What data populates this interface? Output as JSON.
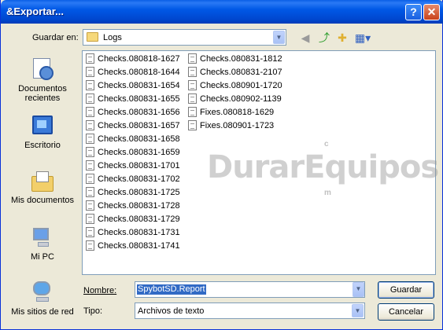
{
  "title": "Exportar...",
  "save_in": {
    "label": "Guardar en:",
    "value": "Logs"
  },
  "places": [
    {
      "label": "Documentos recientes"
    },
    {
      "label": "Escritorio"
    },
    {
      "label": "Mis documentos"
    },
    {
      "label": "Mi PC"
    },
    {
      "label": "Mis sitios de red"
    }
  ],
  "files_col1": [
    "Checks.080818-1627",
    "Checks.080818-1644",
    "Checks.080831-1654",
    "Checks.080831-1655",
    "Checks.080831-1656",
    "Checks.080831-1657",
    "Checks.080831-1658",
    "Checks.080831-1659",
    "Checks.080831-1701",
    "Checks.080831-1702",
    "Checks.080831-1725",
    "Checks.080831-1728",
    "Checks.080831-1729",
    "Checks.080831-1731",
    "Checks.080831-1741"
  ],
  "files_col2": [
    "Checks.080831-1812",
    "Checks.080831-2107",
    "Checks.080901-1720",
    "Checks.080902-1139",
    "Fixes.080818-1629",
    "Fixes.080901-1723"
  ],
  "watermark": "DurarEquipos",
  "filename": {
    "label": "Nombre:",
    "value": "SpybotSD.Report"
  },
  "filetype": {
    "label": "Tipo:",
    "value": "Archivos de texto"
  },
  "buttons": {
    "save": "Guardar",
    "cancel": "Cancelar"
  },
  "icons": {
    "back": "back-arrow-icon",
    "up": "up-folder-icon",
    "new_folder": "new-folder-icon",
    "views": "views-menu-icon"
  }
}
